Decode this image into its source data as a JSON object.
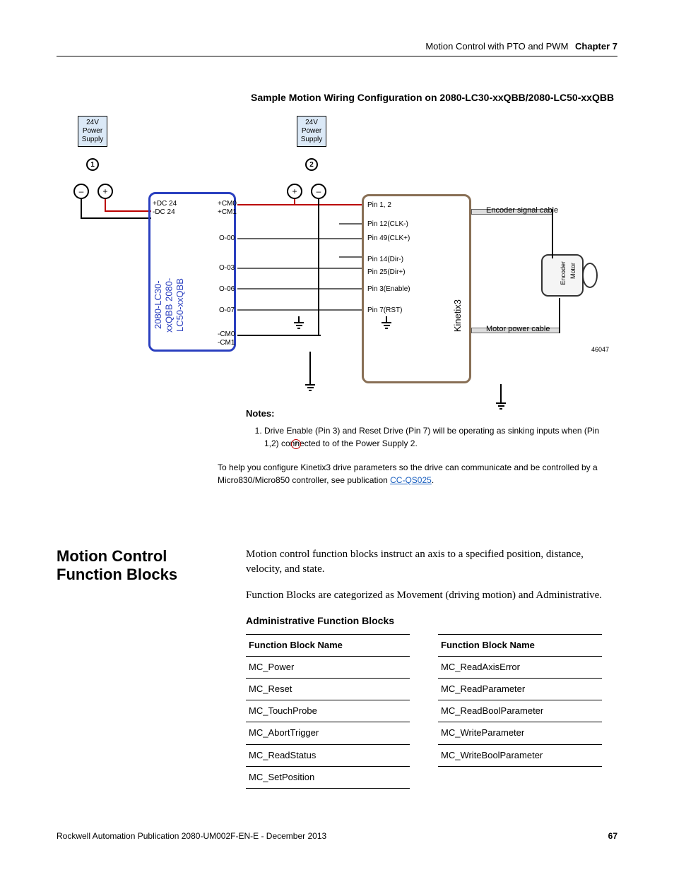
{
  "header": {
    "title": "Motion Control with PTO and PWM",
    "chapter": "Chapter 7"
  },
  "diagram": {
    "title": "Sample Motion Wiring Configuration on 2080-LC30-xxQBB/2080-LC50-xxQBB",
    "psu1": {
      "l1": "24V",
      "l2": "Power",
      "l3": "Supply",
      "badge": "1"
    },
    "psu2": {
      "l1": "24V",
      "l2": "Power",
      "l3": "Supply",
      "badge": "2"
    },
    "plc": {
      "label1": "2080-LC30-xxQBB",
      "label2": "2080-LC50-xxQBB",
      "pins": {
        "dc24p": "+DC 24",
        "dc24m": "-DC 24",
        "cm0p": "+CM0",
        "cm1p": "+CM1",
        "o00": "O-00",
        "o03": "O-03",
        "o06": "O-06",
        "o07": "O-07",
        "cm0m": "-CM0",
        "cm1m": "-CM1"
      }
    },
    "k3": {
      "label": "Kinetix3",
      "pins": {
        "p12": "Pin 1, 2",
        "p12clk": "Pin 12(CLK-)",
        "p49": "Pin 49(CLK+)",
        "p14": "Pin 14(Dir-)",
        "p25": "Pin 25(Dir+)",
        "p3": "Pin 3(Enable)",
        "p7": "Pin 7(RST)"
      }
    },
    "motor": {
      "m": "Motor",
      "e": "Encoder"
    },
    "cables": {
      "enc": "Encoder signal cable",
      "pow": "Motor power cable"
    },
    "figno": "46047",
    "plus": "+",
    "minus": "–"
  },
  "notes": {
    "hdr": "Notes:",
    "items": [
      "Drive Enable (Pin 3) and Reset Drive (Pin 7) will be operating as sinking inputs when (Pin 1,2) connected to        of the Power Supply 2."
    ],
    "plus": "+",
    "help_pre": "To help you configure Kinetix3 drive parameters so the drive can communicate and be controlled by a Micro830/Micro850 controller, see publication ",
    "help_link": "CC-QS025",
    "help_post": "."
  },
  "section": {
    "heading": "Motion Control Function Blocks",
    "p1": "Motion control function blocks instruct an axis to a specified position, distance, velocity, and state.",
    "p2": "Function Blocks are categorized as Movement (driving motion) and Administrative.",
    "tbl_title": "Administrative Function Blocks",
    "col_hdr": "Function Block Name",
    "col1": [
      "MC_Power",
      "MC_Reset",
      "MC_TouchProbe",
      "MC_AbortTrigger",
      "MC_ReadStatus",
      "MC_SetPosition"
    ],
    "col2": [
      "MC_ReadAxisError",
      "MC_ReadParameter",
      "MC_ReadBoolParameter",
      "MC_WriteParameter",
      "MC_WriteBoolParameter"
    ]
  },
  "footer": {
    "pub": "Rockwell Automation Publication 2080-UM002F-EN-E - December 2013",
    "page": "67"
  }
}
